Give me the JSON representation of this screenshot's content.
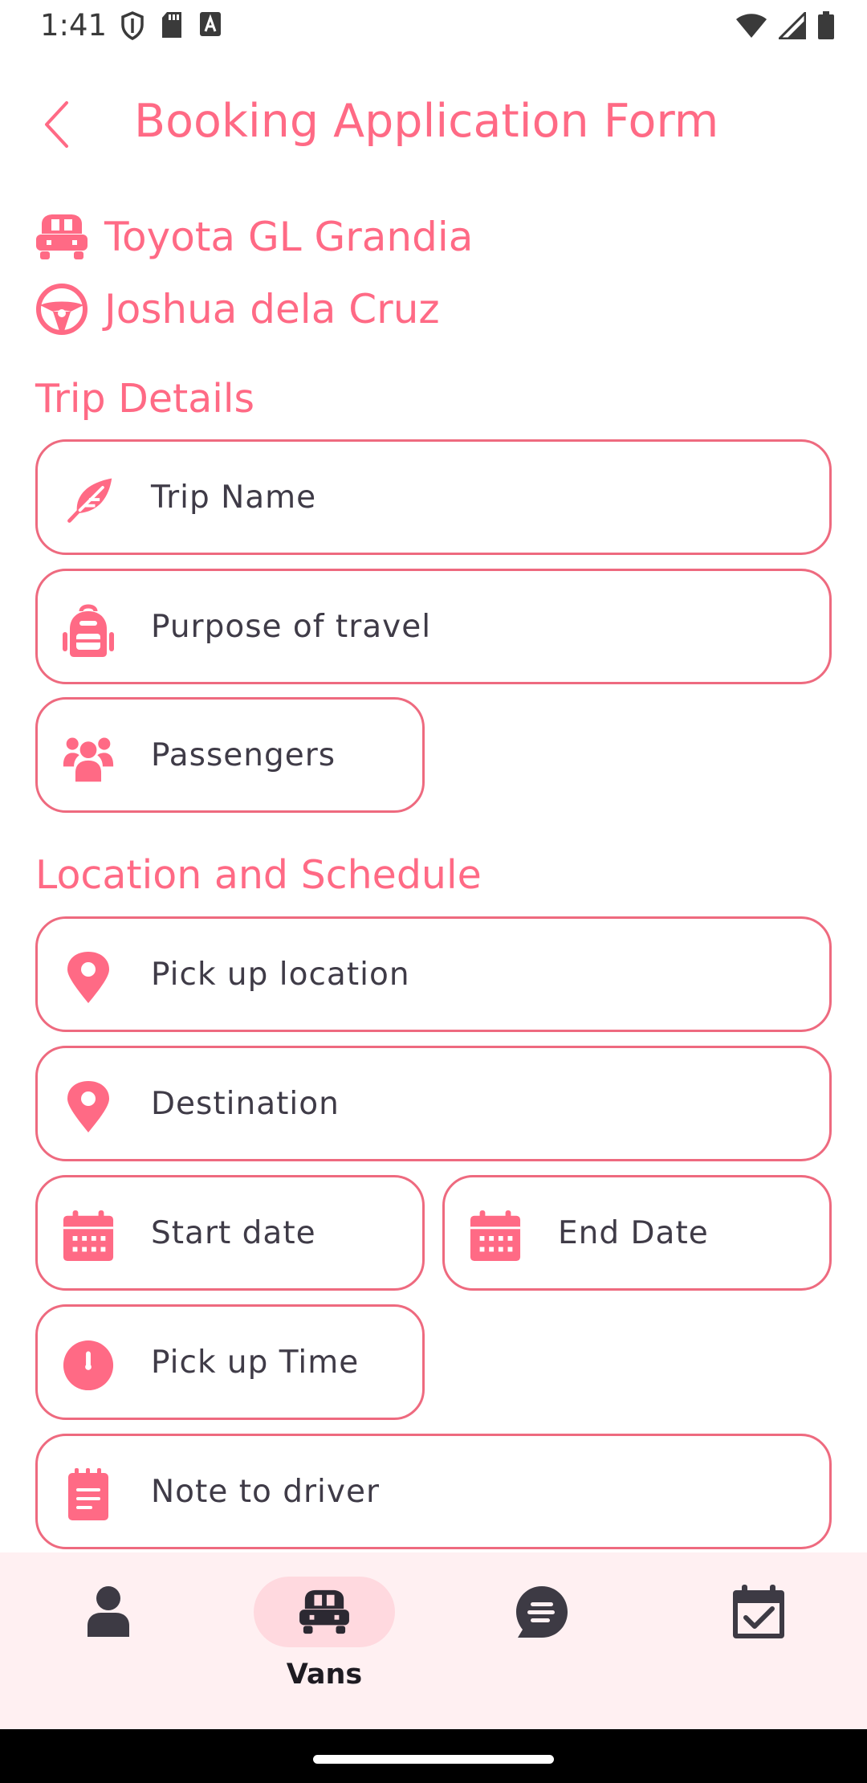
{
  "status_bar": {
    "time": "1:41",
    "icons": [
      "shield-icon",
      "sd-card-icon",
      "keyboard-a-icon",
      "wifi-icon",
      "signal-icon",
      "battery-icon"
    ]
  },
  "header": {
    "title": "Booking Application Form",
    "back_icon": "chevron-left-icon"
  },
  "summary": {
    "vehicle": "Toyota GL Grandia",
    "driver": "Joshua dela Cruz"
  },
  "sections": {
    "trip_details": {
      "title": "Trip Details",
      "fields": {
        "trip_name": {
          "placeholder": "Trip Name",
          "icon": "feather-icon"
        },
        "purpose": {
          "placeholder": "Purpose of travel",
          "icon": "backpack-icon"
        },
        "passengers": {
          "placeholder": "Passengers",
          "icon": "people-icon"
        }
      }
    },
    "location_schedule": {
      "title": "Location and Schedule",
      "fields": {
        "pickup_location": {
          "placeholder": "Pick up location",
          "icon": "location-pin-icon"
        },
        "destination": {
          "placeholder": "Destination",
          "icon": "location-pin-icon"
        },
        "start_date": {
          "placeholder": "Start date",
          "icon": "calendar-icon"
        },
        "end_date": {
          "placeholder": "End Date",
          "icon": "calendar-icon"
        },
        "pickup_time": {
          "placeholder": "Pick up Time",
          "icon": "clock-icon"
        },
        "note": {
          "placeholder": "Note to driver",
          "icon": "notepad-icon"
        }
      }
    }
  },
  "bottom_nav": {
    "active": "vans",
    "items": [
      {
        "id": "profile",
        "icon": "person-icon",
        "label": ""
      },
      {
        "id": "vans",
        "icon": "van-icon",
        "label": "Vans"
      },
      {
        "id": "messages",
        "icon": "chat-icon",
        "label": ""
      },
      {
        "id": "bookings",
        "icon": "calendar-check-icon",
        "label": ""
      }
    ]
  },
  "colors": {
    "accent": "#ff6a85",
    "field_border": "#ee6a7f",
    "nav_background": "#fff0f2",
    "active_pill": "#ffd9df"
  }
}
